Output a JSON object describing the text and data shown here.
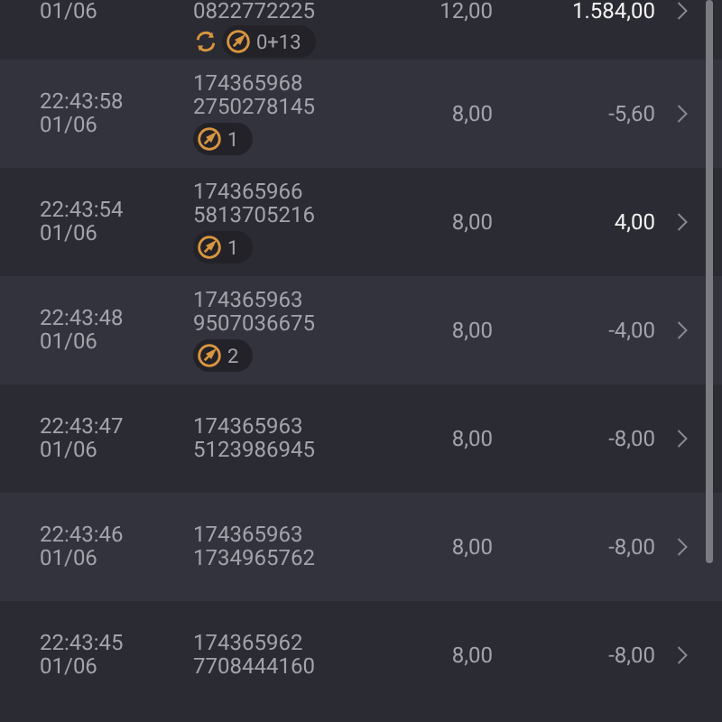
{
  "rows": [
    {
      "time": [],
      "date": "01/06",
      "ids": [
        "0822772225"
      ],
      "badges": [
        {
          "kind": "refresh"
        },
        {
          "kind": "compass",
          "text": "0+13"
        }
      ],
      "stake": "12,00",
      "amount": "1.584,00",
      "positive": true
    },
    {
      "time": [
        "22:43:58"
      ],
      "date": "01/06",
      "ids": [
        "174365968",
        "2750278145"
      ],
      "badges": [
        {
          "kind": "compass",
          "text": "1"
        }
      ],
      "stake": "8,00",
      "amount": "-5,60",
      "positive": false
    },
    {
      "time": [
        "22:43:54"
      ],
      "date": "01/06",
      "ids": [
        "174365966",
        "5813705216"
      ],
      "badges": [
        {
          "kind": "compass",
          "text": "1"
        }
      ],
      "stake": "8,00",
      "amount": "4,00",
      "positive": true
    },
    {
      "time": [
        "22:43:48"
      ],
      "date": "01/06",
      "ids": [
        "174365963",
        "9507036675"
      ],
      "badges": [
        {
          "kind": "compass",
          "text": "2"
        }
      ],
      "stake": "8,00",
      "amount": "-4,00",
      "positive": false
    },
    {
      "time": [
        "22:43:47"
      ],
      "date": "01/06",
      "ids": [
        "174365963",
        "5123986945"
      ],
      "badges": [],
      "stake": "8,00",
      "amount": "-8,00",
      "positive": false
    },
    {
      "time": [
        "22:43:46"
      ],
      "date": "01/06",
      "ids": [
        "174365963",
        "1734965762"
      ],
      "badges": [],
      "stake": "8,00",
      "amount": "-8,00",
      "positive": false
    },
    {
      "time": [
        "22:43:45"
      ],
      "date": "01/06",
      "ids": [
        "174365962",
        "7708444160"
      ],
      "badges": [],
      "stake": "8,00",
      "amount": "-8,00",
      "positive": false
    }
  ]
}
